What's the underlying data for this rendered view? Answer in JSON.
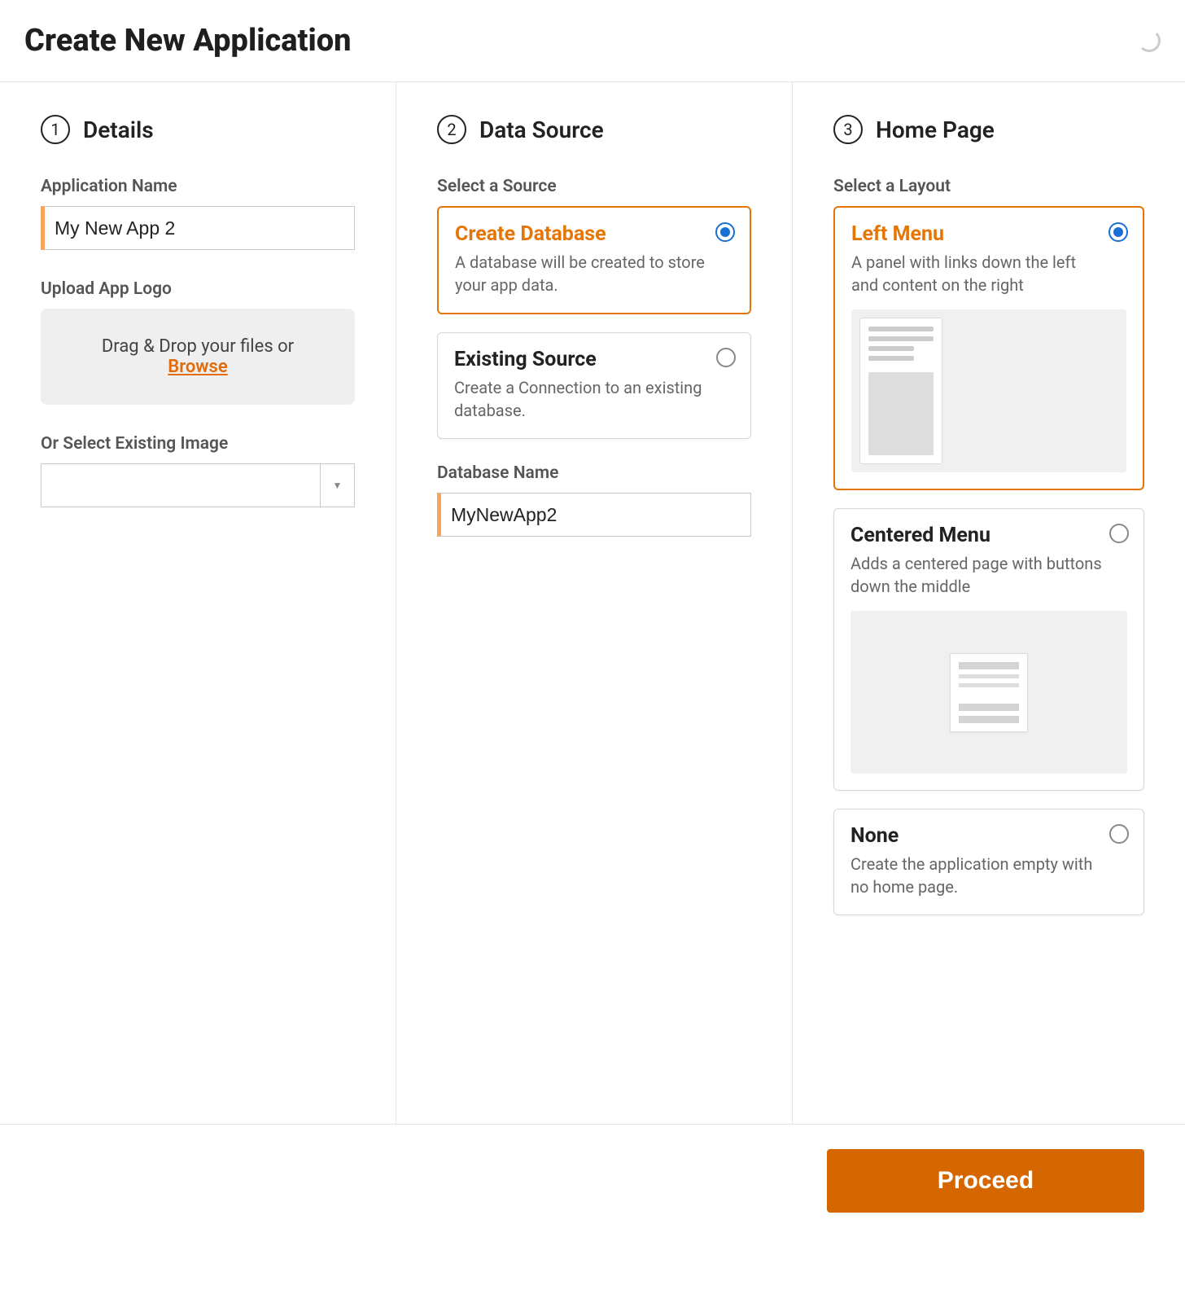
{
  "header": {
    "title": "Create New Application"
  },
  "steps": {
    "details": {
      "number": "1",
      "title": "Details"
    },
    "datasource": {
      "number": "2",
      "title": "Data Source"
    },
    "homepage": {
      "number": "3",
      "title": "Home Page"
    }
  },
  "details": {
    "app_name_label": "Application Name",
    "app_name_value": "My New App 2",
    "upload_label": "Upload App Logo",
    "upload_text": "Drag & Drop your files or ",
    "browse_label": "Browse",
    "existing_image_label": "Or Select Existing Image"
  },
  "datasource": {
    "select_label": "Select a Source",
    "options": [
      {
        "title": "Create Database",
        "desc": "A database will be created to store your app data.",
        "selected": true
      },
      {
        "title": "Existing Source",
        "desc": "Create a Connection to an existing database.",
        "selected": false
      }
    ],
    "db_name_label": "Database Name",
    "db_name_value": "MyNewApp2"
  },
  "homepage": {
    "select_label": "Select a Layout",
    "options": [
      {
        "title": "Left Menu",
        "desc": "A panel with links down the left and content on the right",
        "selected": true,
        "preview": "left"
      },
      {
        "title": "Centered Menu",
        "desc": "Adds a centered page with buttons down the middle",
        "selected": false,
        "preview": "center"
      },
      {
        "title": "None",
        "desc": "Create the application empty with no home page.",
        "selected": false,
        "preview": "none"
      }
    ]
  },
  "footer": {
    "proceed_label": "Proceed"
  }
}
